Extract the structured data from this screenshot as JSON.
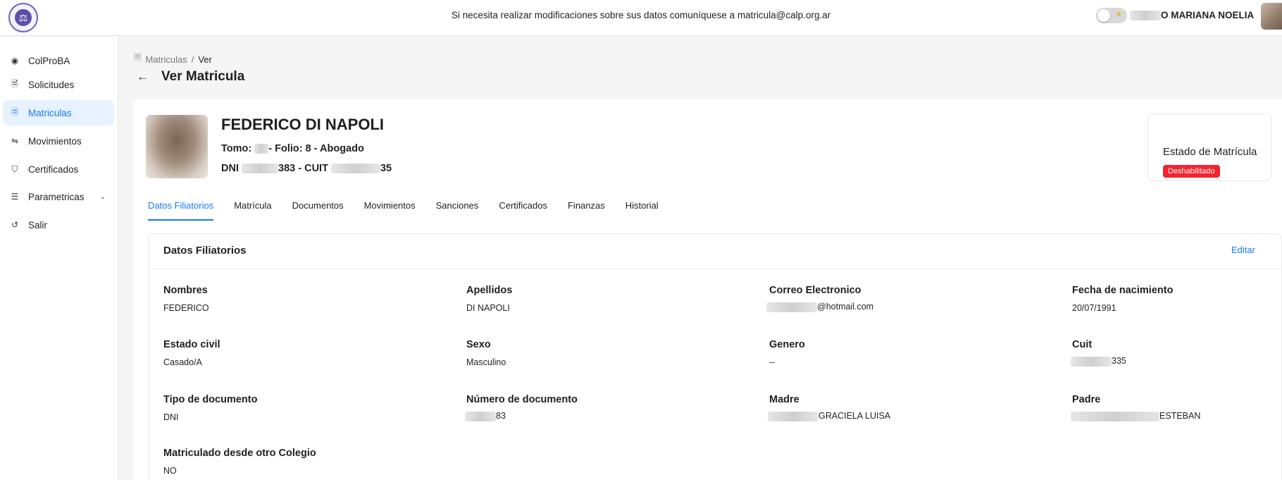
{
  "header": {
    "notice": "Si necesita realizar modificaciones sobre sus datos comuníquese a matricula@calp.org.ar",
    "user_name_suffix": "O MARIANA NOELIA"
  },
  "sidebar": {
    "items": [
      {
        "label": "ColProBA",
        "icon": "colproba-icon"
      },
      {
        "label": "Solicitudes",
        "icon": "file-icon"
      },
      {
        "label": "Matriculas",
        "icon": "id-file-icon"
      },
      {
        "label": "Movimientos",
        "icon": "swap-icon"
      },
      {
        "label": "Certificados",
        "icon": "shield-check-icon"
      },
      {
        "label": "Parametricas",
        "icon": "list-icon"
      },
      {
        "label": "Salir",
        "icon": "logout-icon"
      }
    ]
  },
  "breadcrumb": {
    "parent": "Matriculas",
    "separator": "/",
    "current": "Ver"
  },
  "page": {
    "title": "Ver Matricula"
  },
  "profile": {
    "name": "FEDERICO DI NAPOLI",
    "tomo_prefix": "Tomo:",
    "tomo_suffix": "- Folio: 8 - Abogado",
    "dni_prefix": "DNI",
    "dni_mid": "383 - CUIT",
    "cuit_suffix": "35"
  },
  "estado": {
    "title": "Estado de Matrícula",
    "badge": "Deshabilitado",
    "badge_color": "#f5222d"
  },
  "tabs": [
    "Datos Filiatorios",
    "Matrícula",
    "Documentos",
    "Movimientos",
    "Sanciones",
    "Certificados",
    "Finanzas",
    "Historial"
  ],
  "panel": {
    "title": "Datos Filiatorios",
    "edit_label": "Editar",
    "fields": [
      {
        "label": "Nombres",
        "value": "FEDERICO"
      },
      {
        "label": "Apellidos",
        "value": "DI NAPOLI"
      },
      {
        "label": "Correo Electronico",
        "value": "@hotmail.com"
      },
      {
        "label": "Fecha de nacimiento",
        "value": "20/07/1991"
      },
      {
        "label": "Estado civil",
        "value": "Casado/A"
      },
      {
        "label": "Sexo",
        "value": "Masculino"
      },
      {
        "label": "Genero",
        "value": "--"
      },
      {
        "label": "Cuit",
        "value": "335"
      },
      {
        "label": "Tipo de documento",
        "value": "DNI"
      },
      {
        "label": "Número de documento",
        "value": "83"
      },
      {
        "label": "Madre",
        "value": "GRACIELA LUISA"
      },
      {
        "label": "Padre",
        "value": "ESTEBAN"
      },
      {
        "label": "Matriculado desde otro Colegio",
        "value": "NO"
      }
    ]
  },
  "colors": {
    "accent": "#1677ff",
    "active_bg": "#e6f2ff"
  }
}
